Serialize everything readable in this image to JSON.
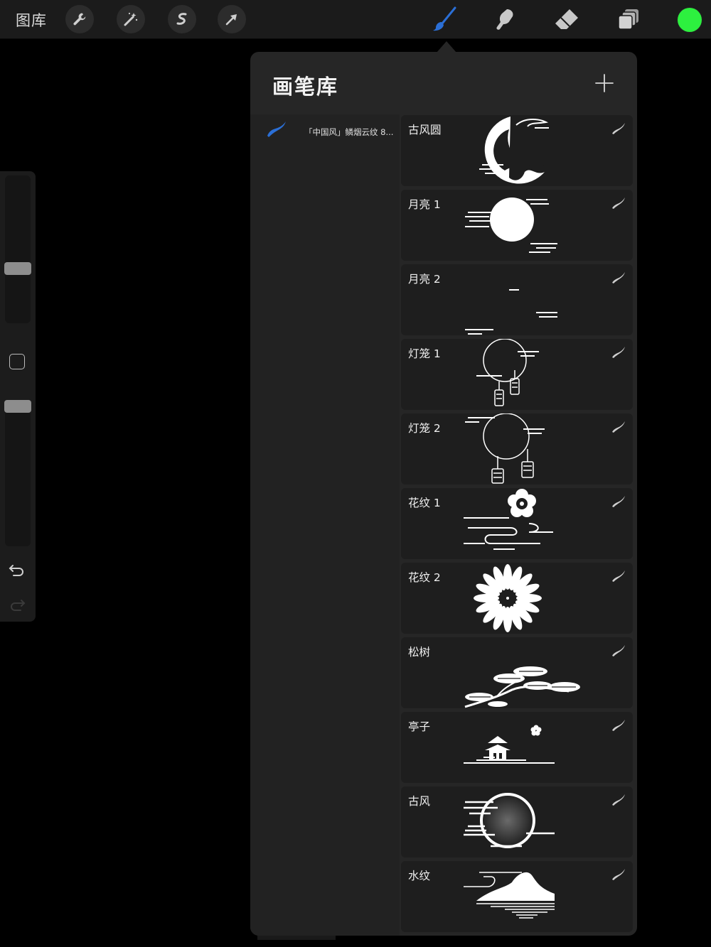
{
  "toolbar": {
    "gallery_label": "图库",
    "tools": [
      {
        "icon": "wrench-icon",
        "active": false
      },
      {
        "icon": "magic-wand-icon",
        "active": false
      },
      {
        "icon": "selection-icon",
        "active": false
      },
      {
        "icon": "transform-arrow-icon",
        "active": false
      }
    ],
    "painting_tools": [
      {
        "icon": "brush-icon",
        "active": true
      },
      {
        "icon": "smudge-icon",
        "active": false
      },
      {
        "icon": "eraser-icon",
        "active": false
      },
      {
        "icon": "layers-icon",
        "active": false
      }
    ],
    "accent_color": "#2b6fd6",
    "current_color": "#2df03f"
  },
  "sidebar": {
    "size_slider_level": 0.36,
    "opacity_slider_level": 0.0
  },
  "brush_library": {
    "title": "画笔库",
    "sets": [
      {
        "label": "「中国风」鳞烟云纹 8...",
        "selected": true
      }
    ],
    "brushes": [
      {
        "name": "古风圆",
        "stroke": "ancient-circle"
      },
      {
        "name": "月亮 1",
        "stroke": "full-moon-clouds"
      },
      {
        "name": "月亮 2",
        "stroke": "crescent-moon"
      },
      {
        "name": "灯笼 1",
        "stroke": "lantern-circle-1"
      },
      {
        "name": "灯笼 2",
        "stroke": "lantern-circle-2"
      },
      {
        "name": "花纹 1",
        "stroke": "plum-blossom-waves"
      },
      {
        "name": "花纹 2",
        "stroke": "chrysanthemum"
      },
      {
        "name": "松树",
        "stroke": "pine-tree"
      },
      {
        "name": "亭子",
        "stroke": "pavilion"
      },
      {
        "name": "古风",
        "stroke": "glowing-moon"
      },
      {
        "name": "水纹",
        "stroke": "mountain-water"
      }
    ]
  }
}
